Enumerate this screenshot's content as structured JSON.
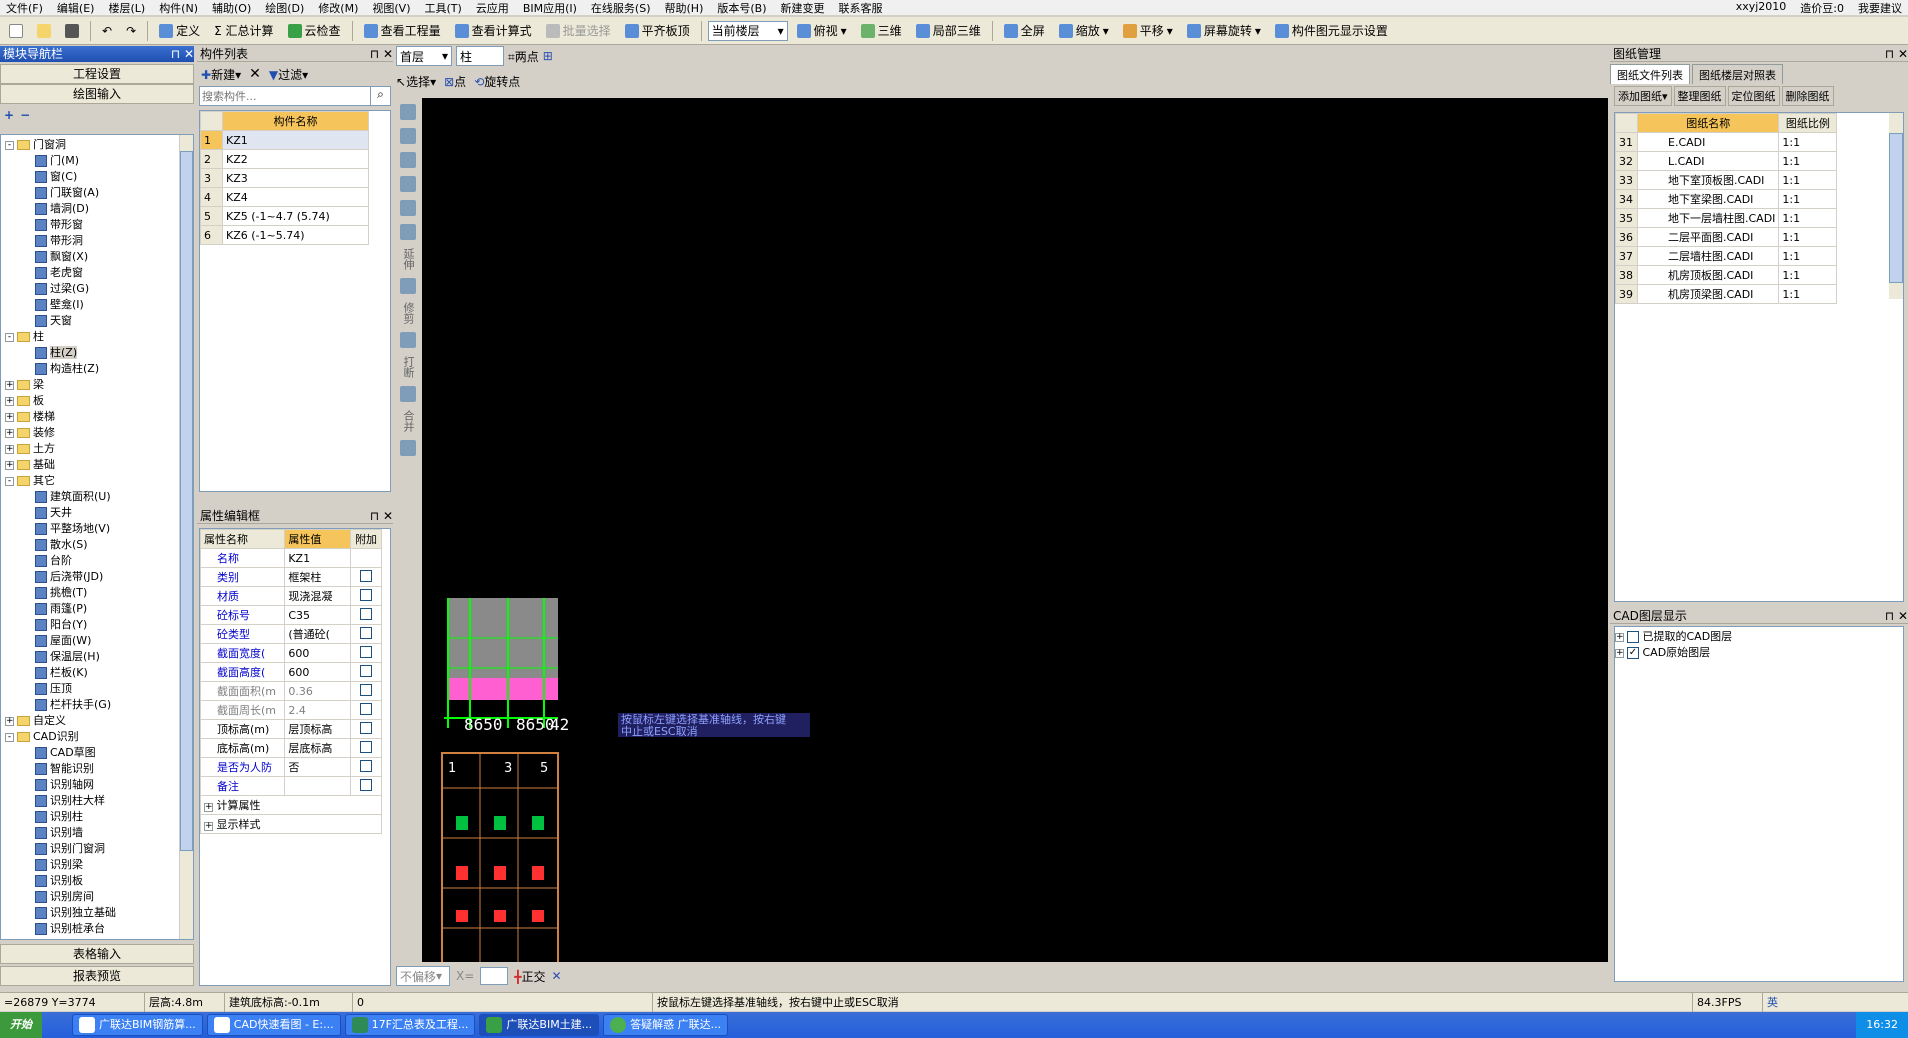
{
  "menu": [
    "文件(F)",
    "编辑(E)",
    "楼层(L)",
    "构件(N)",
    "辅助(O)",
    "绘图(D)",
    "修改(M)",
    "视图(V)",
    "工具(T)",
    "云应用",
    "BIM应用(I)",
    "在线服务(S)",
    "帮助(H)",
    "版本号(B)",
    "新建变更",
    "联系客服"
  ],
  "menu_right": {
    "user": "xxyj2010",
    "price": "造价豆:0",
    "help": "我要建议"
  },
  "toolbar": {
    "items": [
      "定义",
      "Σ 汇总计算",
      "云检查",
      "查看工程量",
      "查看计算式",
      "批量选择",
      "平齐板顶"
    ],
    "floor_combo": "当前楼层",
    "view_items": [
      "俯视",
      "三维",
      "局部三维",
      "全屏",
      "缩放",
      "平移",
      "屏幕旋转",
      "构件图元显示设置"
    ]
  },
  "left_nav": {
    "title": "模块导航栏",
    "btn_project": "工程设置",
    "btn_draw": "绘图输入",
    "btn_table": "表格输入",
    "btn_report": "报表预览",
    "tree": [
      {
        "level": 0,
        "exp": "-",
        "label": "门窗洞",
        "type": "folder"
      },
      {
        "level": 1,
        "label": "门(M)"
      },
      {
        "level": 1,
        "label": "窗(C)"
      },
      {
        "level": 1,
        "label": "门联窗(A)"
      },
      {
        "level": 1,
        "label": "墙洞(D)"
      },
      {
        "level": 1,
        "label": "带形窗"
      },
      {
        "level": 1,
        "label": "带形洞"
      },
      {
        "level": 1,
        "label": "飘窗(X)"
      },
      {
        "level": 1,
        "label": "老虎窗"
      },
      {
        "level": 1,
        "label": "过梁(G)"
      },
      {
        "level": 1,
        "label": "壁龛(I)"
      },
      {
        "level": 1,
        "label": "天窗"
      },
      {
        "level": 0,
        "exp": "-",
        "label": "柱",
        "type": "folder"
      },
      {
        "level": 1,
        "label": "柱(Z)"
      },
      {
        "level": 1,
        "label": "构造柱(Z)"
      },
      {
        "level": 0,
        "exp": "+",
        "label": "梁",
        "type": "folder"
      },
      {
        "level": 0,
        "exp": "+",
        "label": "板",
        "type": "folder"
      },
      {
        "level": 0,
        "exp": "+",
        "label": "楼梯",
        "type": "folder"
      },
      {
        "level": 0,
        "exp": "+",
        "label": "装修",
        "type": "folder"
      },
      {
        "level": 0,
        "exp": "+",
        "label": "土方",
        "type": "folder"
      },
      {
        "level": 0,
        "exp": "+",
        "label": "基础",
        "type": "folder"
      },
      {
        "level": 0,
        "exp": "-",
        "label": "其它",
        "type": "folder"
      },
      {
        "level": 1,
        "label": "建筑面积(U)"
      },
      {
        "level": 1,
        "label": "天井"
      },
      {
        "level": 1,
        "label": "平整场地(V)"
      },
      {
        "level": 1,
        "label": "散水(S)"
      },
      {
        "level": 1,
        "label": "台阶"
      },
      {
        "level": 1,
        "label": "后浇带(JD)"
      },
      {
        "level": 1,
        "label": "挑檐(T)"
      },
      {
        "level": 1,
        "label": "雨篷(P)"
      },
      {
        "level": 1,
        "label": "阳台(Y)"
      },
      {
        "level": 1,
        "label": "屋面(W)"
      },
      {
        "level": 1,
        "label": "保温层(H)"
      },
      {
        "level": 1,
        "label": "栏板(K)"
      },
      {
        "level": 1,
        "label": "压顶"
      },
      {
        "level": 1,
        "label": "栏杆扶手(G)"
      },
      {
        "level": 0,
        "exp": "+",
        "label": "自定义",
        "type": "folder"
      },
      {
        "level": 0,
        "exp": "-",
        "label": "CAD识别",
        "type": "folder"
      },
      {
        "level": 1,
        "label": "CAD草图"
      },
      {
        "level": 1,
        "label": "智能识别"
      },
      {
        "level": 1,
        "label": "识别轴网"
      },
      {
        "level": 1,
        "label": "识别柱大样"
      },
      {
        "level": 1,
        "label": "识别柱"
      },
      {
        "level": 1,
        "label": "识别墙"
      },
      {
        "level": 1,
        "label": "识别门窗洞"
      },
      {
        "level": 1,
        "label": "识别梁"
      },
      {
        "level": 1,
        "label": "识别板"
      },
      {
        "level": 1,
        "label": "识别房间"
      },
      {
        "level": 1,
        "label": "识别独立基础"
      },
      {
        "level": 1,
        "label": "识别桩承台"
      }
    ]
  },
  "component_list": {
    "title": "构件列表",
    "new": "新建",
    "filter": "过滤",
    "search_placeholder": "搜索构件...",
    "header": "构件名称",
    "rows": [
      {
        "n": "1",
        "name": "KZ1"
      },
      {
        "n": "2",
        "name": "KZ2"
      },
      {
        "n": "3",
        "name": "KZ3"
      },
      {
        "n": "4",
        "name": "KZ4"
      },
      {
        "n": "5",
        "name": "KZ5 (-1~4.7 (5.74)"
      },
      {
        "n": "6",
        "name": "KZ6 (-1~5.74)"
      }
    ]
  },
  "props": {
    "title": "属性编辑框",
    "h_name": "属性名称",
    "h_value": "属性值",
    "h_extra": "附加",
    "rows": [
      {
        "name": "名称",
        "value": "KZ1",
        "style": "blue",
        "chk": false
      },
      {
        "name": "类别",
        "value": "框架柱",
        "style": "blue",
        "chk": true
      },
      {
        "name": "材质",
        "value": "现浇混凝",
        "style": "blue",
        "chk": true
      },
      {
        "name": "砼标号",
        "value": "C35",
        "style": "blue",
        "chk": true
      },
      {
        "name": "砼类型",
        "value": "(普通砼(",
        "style": "blue",
        "chk": true
      },
      {
        "name": "截面宽度(",
        "value": "600",
        "style": "blue",
        "chk": true
      },
      {
        "name": "截面高度(",
        "value": "600",
        "style": "blue",
        "chk": true
      },
      {
        "name": "截面面积(m",
        "value": "0.36",
        "style": "grey",
        "chk": true
      },
      {
        "name": "截面周长(m",
        "value": "2.4",
        "style": "grey",
        "chk": true
      },
      {
        "name": "顶标高(m)",
        "value": "层顶标高",
        "style": "",
        "chk": true
      },
      {
        "name": "底标高(m)",
        "value": "层底标高",
        "style": "",
        "chk": true
      },
      {
        "name": "是否为人防",
        "value": "否",
        "style": "blue",
        "chk": true
      },
      {
        "name": "备注",
        "value": "",
        "style": "blue",
        "chk": true
      }
    ],
    "groups": [
      "计算属性",
      "显示样式"
    ]
  },
  "canvas_bar": {
    "floor": "首层",
    "type": "柱",
    "two_points": "两点",
    "select": "选择",
    "point": "点",
    "rotate_point": "旋转点"
  },
  "side_tools": [
    "延伸",
    "修剪",
    "打断",
    "合并"
  ],
  "canvas": {
    "tooltip_line1": "按鼠标左键选择基准轴线，按右键",
    "tooltip_line2": "中止或ESC取消",
    "dims": [
      "8650",
      "8650",
      "42"
    ],
    "axes": [
      "1",
      "3",
      "5"
    ]
  },
  "bottom_bar": {
    "offset": "不偏移",
    "x": "X=",
    "ortho": "正交"
  },
  "drawing_mgr": {
    "title": "图纸管理",
    "tab1": "图纸文件列表",
    "tab2": "图纸楼层对照表",
    "btns": [
      "添加图纸",
      "整理图纸",
      "定位图纸",
      "删除图纸"
    ],
    "h_name": "图纸名称",
    "h_scale": "图纸比例",
    "rows": [
      {
        "n": "31",
        "name": "E.CADI",
        "scale": "1:1"
      },
      {
        "n": "32",
        "name": "L.CADI",
        "scale": "1:1"
      },
      {
        "n": "33",
        "name": "地下室顶板图.CADI",
        "scale": "1:1"
      },
      {
        "n": "34",
        "name": "地下室梁图.CADI",
        "scale": "1:1"
      },
      {
        "n": "35",
        "name": "地下一层墙柱图.CADI",
        "scale": "1:1"
      },
      {
        "n": "36",
        "name": "二层平面图.CADI",
        "scale": "1:1"
      },
      {
        "n": "37",
        "name": "二层墙柱图.CADI",
        "scale": "1:1"
      },
      {
        "n": "38",
        "name": "机房顶板图.CADI",
        "scale": "1:1"
      },
      {
        "n": "39",
        "name": "机房顶梁图.CADI",
        "scale": "1:1"
      }
    ]
  },
  "cad_layers": {
    "title": "CAD图层显示",
    "items": [
      {
        "label": "已提取的CAD图层",
        "checked": false
      },
      {
        "label": "CAD原始图层",
        "checked": true
      }
    ]
  },
  "status": {
    "coords": "=26879 Y=3774",
    "floor_h": "层高:4.8m",
    "base_elev": "建筑底标高:-0.1m",
    "zero": "0",
    "msg": "按鼠标左键选择基准轴线，按右键中止或ESC取消",
    "fps": "84.3FPS"
  },
  "taskbar": {
    "start": "开始",
    "tasks": [
      "广联达BIM钢筋算...",
      "CAD快速看图 - E:...",
      "17F汇总表及工程...",
      "广联达BIM土建...",
      "答疑解惑 广联达..."
    ],
    "ime": "英",
    "time": "16:32"
  }
}
